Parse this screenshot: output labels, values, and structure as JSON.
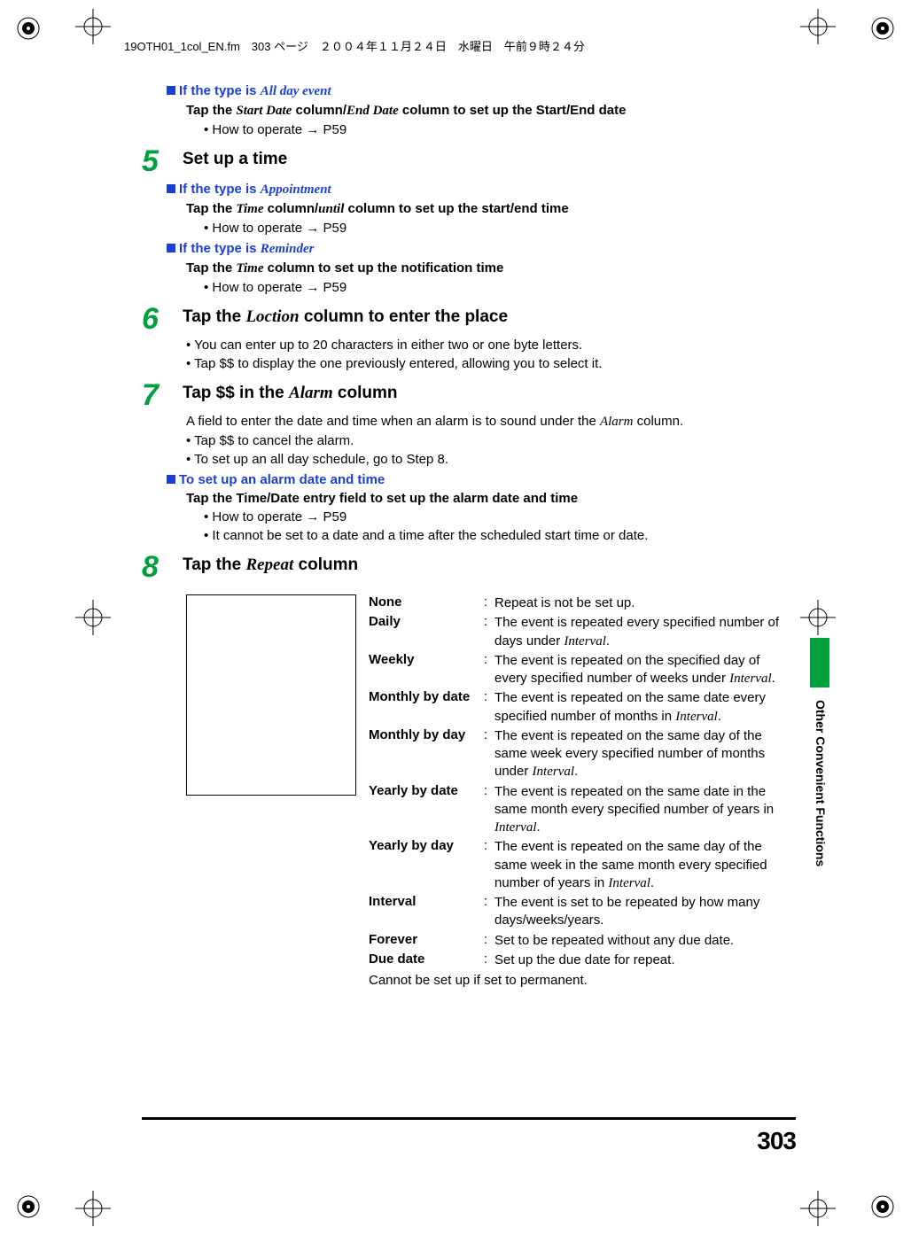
{
  "printer_header": "19OTH01_1col_EN.fm　303 ページ　２００４年１１月２４日　水曜日　午前９時２４分",
  "section_side": "Other Convenient Functions",
  "page_number": "303",
  "intro": {
    "heading_label": "If the type is ",
    "heading_em": "All day event",
    "tap_prefix": "Tap the ",
    "tap_em1": "Start Date",
    "tap_mid": " column/",
    "tap_em2": "End Date",
    "tap_suffix": " column to set up the Start/End date",
    "bullet": "How to operate → P59"
  },
  "step5": {
    "num": "5",
    "title": "Set up a time",
    "h1_label": "If the type is ",
    "h1_em": "Appointment",
    "t1_prefix": "Tap the ",
    "t1_em1": "Time",
    "t1_mid": " column/",
    "t1_em2": "until",
    "t1_suffix": " column to set up the start/end time",
    "b1": "How to operate → P59",
    "h2_label": "If the type is ",
    "h2_em": "Reminder",
    "t2_prefix": "Tap the ",
    "t2_em1": "Time",
    "t2_suffix": " column to set up the notification time",
    "b2": "How to operate → P59"
  },
  "step6": {
    "num": "6",
    "title_prefix": "Tap the ",
    "title_em": "Loction",
    "title_suffix": " column to enter the place",
    "b1": "You can enter up to 20 characters in either two or one byte letters.",
    "b2": "Tap $$ to display the one previously entered, allowing you to select it."
  },
  "step7": {
    "num": "7",
    "title_prefix": "Tap $$ in the ",
    "title_em": "Alarm",
    "title_suffix": " column",
    "p_prefix": "A field to enter the date and time when an alarm is to sound under the ",
    "p_em": "Alarm",
    "p_suffix": " column.",
    "b1": "Tap $$ to cancel the alarm.",
    "b2": "To set up an all day schedule, go to Step 8.",
    "h1": "To set up an alarm date and time",
    "t1": "Tap the Time/Date entry field to set up the alarm date and time",
    "sb1": "How to operate → P59",
    "sb2": "It cannot be set to a date and a time after the scheduled start time or date."
  },
  "step8": {
    "num": "8",
    "title_prefix": "Tap the ",
    "title_em": "Repeat",
    "title_suffix": " column",
    "defs": [
      {
        "label": "None",
        "desc_parts": [
          "Repeat is not be set up."
        ]
      },
      {
        "label": "Daily",
        "desc_parts": [
          "The event is repeated every specified number of days under ",
          {
            "em": "Interval"
          },
          "."
        ]
      },
      {
        "label": "Weekly",
        "desc_parts": [
          "The event is repeated on the specified day of every specified number of weeks under ",
          {
            "em": "Interval"
          },
          "."
        ]
      },
      {
        "label": "Monthly by date",
        "desc_parts": [
          "The event is repeated on the same date every specified number of months in ",
          {
            "em": "Interval"
          },
          "."
        ]
      },
      {
        "label": "Monthly by day",
        "desc_parts": [
          "The event is repeated on the same day of the same week every specified number of months under ",
          {
            "em": "Interval"
          },
          "."
        ]
      },
      {
        "label": "Yearly by date",
        "desc_parts": [
          "The event is repeated on the same date in the same month every specified number of years in ",
          {
            "em": "Interval"
          },
          "."
        ]
      },
      {
        "label": "Yearly by day",
        "desc_parts": [
          "The event is repeated on the same day of the same week in the same month every specified number of years in ",
          {
            "em": "Interval"
          },
          "."
        ]
      },
      {
        "label": "Interval",
        "desc_parts": [
          "The event is set to be repeated by how many days/weeks/years."
        ]
      },
      {
        "label": "Forever",
        "desc_parts": [
          "Set to be repeated without any due date."
        ]
      },
      {
        "label": "Due date",
        "desc_parts": [
          "Set up the due date for repeat."
        ]
      }
    ],
    "note": "Cannot be set up if set to permanent."
  }
}
